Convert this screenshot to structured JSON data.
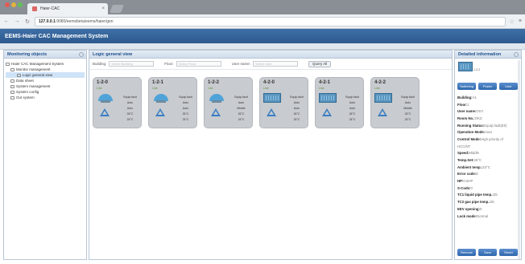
{
  "browser": {
    "tab_title": "Haier-CAC",
    "tab_close": "×",
    "url_host": "127.0.0.1",
    "url_path": ":9080/eemsbeta/eems/haier/gen",
    "back_icon": "arrow-left-icon",
    "forward_icon": "arrow-right-icon",
    "reload_icon": "reload-icon"
  },
  "app": {
    "title": "EEMS-Haier CAC Management System"
  },
  "left_panel": {
    "title": "Monitoring objects",
    "tree": [
      {
        "label": "Haier CAC Management System",
        "level": 0
      },
      {
        "label": "Monitor management",
        "level": 1
      },
      {
        "label": "Logic general view",
        "level": 2,
        "selected": true
      },
      {
        "label": "Data sheet",
        "level": 1
      },
      {
        "label": "System management",
        "level": 1
      },
      {
        "label": "System config",
        "level": 1
      },
      {
        "label": "Out system",
        "level": 1
      }
    ]
  },
  "center_panel": {
    "title": "Logic general view",
    "filters": {
      "building_label": "Building:",
      "building_placeholder": "Select Building",
      "floor_label": "Floor:",
      "floor_placeholder": "Select Floor",
      "username_label": "User name:",
      "username_placeholder": "Select User",
      "search_label": "Query All"
    },
    "cards": [
      {
        "name": "1-2-0",
        "sub": "Line",
        "unit": "cassette",
        "values": [
          "Equip.fault",
          "Auto",
          "Auto",
          "26°C",
          "24°C"
        ]
      },
      {
        "name": "1-2-1",
        "sub": "Line",
        "unit": "cassette",
        "values": [
          "Equip.fault",
          "Auto",
          "Auto",
          "26°C",
          "24°C"
        ]
      },
      {
        "name": "1-2-2",
        "sub": "Line",
        "unit": "cassette",
        "values": [
          "Equip.fault",
          "Auto",
          "Middle",
          "26°C",
          "24°C"
        ]
      },
      {
        "name": "4-2-0",
        "sub": "Line",
        "unit": "duct",
        "values": [
          "Equip.fault",
          "Auto",
          "Auto",
          "26°C",
          "24°C"
        ]
      },
      {
        "name": "4-2-1",
        "sub": "Line",
        "unit": "duct",
        "values": [
          "Equip.fault",
          "Auto",
          "Auto",
          "26°C",
          "24°C"
        ]
      },
      {
        "name": "4-2-2",
        "sub": "Line",
        "unit": "duct",
        "values": [
          "Equip.fault",
          "Auto",
          "Middle",
          "26°C",
          "24°C"
        ]
      }
    ]
  },
  "right_panel": {
    "title": "Detailed information",
    "unit_label": "1-2-2",
    "top_buttons": [
      "Switching",
      "Power",
      "User"
    ],
    "rows": [
      {
        "k": "Building:",
        "v": "A1"
      },
      {
        "k": "Floor:",
        "v": "1"
      },
      {
        "k": "User name:",
        "v": "OSY"
      },
      {
        "k": "Room No.:",
        "v": "OKZ"
      },
      {
        "k": "Running Status:",
        "v": "Equip.fault(E0)"
      },
      {
        "k": "Operation Mode:",
        "v": "Auto"
      },
      {
        "k": "Control Mode:",
        "v": "High priority of"
      },
      {
        "k": "",
        "v": "HCC/NT"
      },
      {
        "k": "Speed:",
        "v": "Middle"
      },
      {
        "k": "Temp.Set:",
        "v": "26°C"
      },
      {
        "k": "Ambient temp.:",
        "v": "23°C"
      },
      {
        "k": "Error code:",
        "v": "E"
      },
      {
        "k": "HP:",
        "v": "0.5HP"
      },
      {
        "k": "S-Code:",
        "v": "0"
      },
      {
        "k": "TC1 liquid pipe temp.:",
        "v": "25"
      },
      {
        "k": "TC2 gas pipe temp.:",
        "v": "25"
      },
      {
        "k": "EEV opening:",
        "v": "0"
      },
      {
        "k": "Lock mode:",
        "v": "Normal"
      }
    ],
    "bottom_buttons": [
      "Remove",
      "Save",
      "Reset"
    ]
  },
  "colors": {
    "header_bg": "#2d5a8f",
    "accent_blue": "#3b7fc4",
    "card_bg": "#c8cbcf"
  }
}
